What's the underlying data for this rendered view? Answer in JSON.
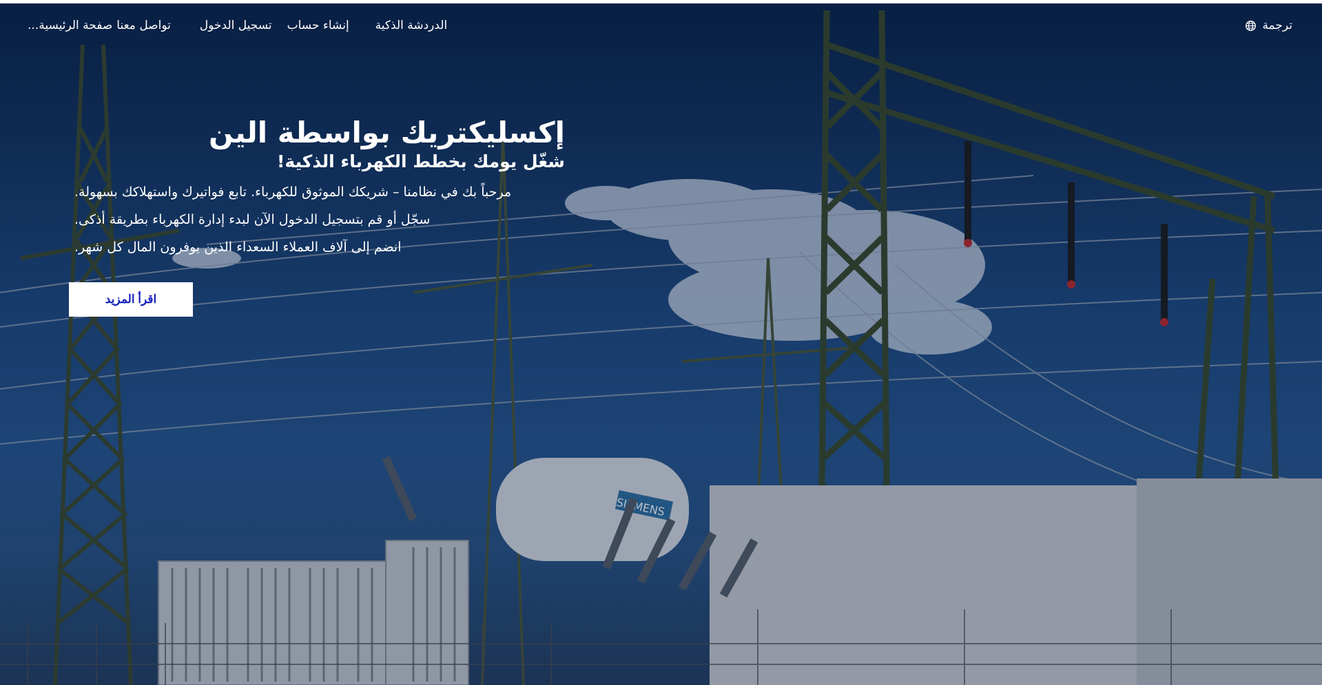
{
  "nav": {
    "translate_label": "ترجمة",
    "links": {
      "chat": "الدردشة الذكية",
      "register": "إنشاء حساب",
      "login": "تسجيل الدخول",
      "contact": "تواصل معنا",
      "home": "صفحة الرئيسية..."
    }
  },
  "hero": {
    "title": "إكسليكتريك بواسطة الين",
    "subtitle": "شغّل يومك بخطط الكهرباء الذكية!",
    "paragraphs": [
      "مرحباً بك في نظامنا – شريكك الموثوق للكهرباء. تابع فواتيرك واستهلاكك بسهولة.",
      "سجّل أو قم بتسجيل الدخول الآن لبدء إدارة الكهرباء بطريقة أذكى.",
      "انضم إلى آلاف العملاء السعداء الذين يوفرون المال كل شهر."
    ],
    "read_more": "اقرأ المزيد",
    "transformer_brand": "SIEMENS"
  },
  "colors": {
    "sky_top": "#0a2348",
    "sky_mid": "#27578f",
    "button_text": "#1320b8",
    "text": "#ffffff"
  }
}
